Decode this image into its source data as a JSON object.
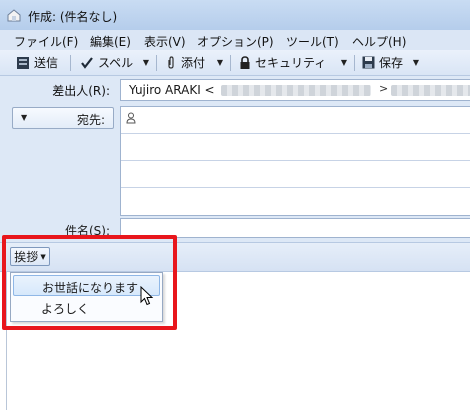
{
  "window": {
    "title": "作成: (件名なし)"
  },
  "menu": [
    "ファイル(F)",
    "編集(E)",
    "表示(V)",
    "オプション(P)",
    "ツール(T)",
    "ヘルプ(H)"
  ],
  "toolbar": {
    "send": "送信",
    "spell": "スペル",
    "attach": "添付",
    "security": "セキュリティ",
    "save": "保存"
  },
  "compose": {
    "from_label": "差出人(R):",
    "from_value": "Yujiro ARAKI <",
    "from_value_end": ">",
    "to_label": "宛先:",
    "subject_label": "件名(S):",
    "subject_value": ""
  },
  "greeting": {
    "button_label": "挨拶",
    "items": [
      "お世話になります",
      "よろしく"
    ]
  },
  "colors": {
    "highlight": "#e8161c",
    "accent": "#dde8f6"
  }
}
